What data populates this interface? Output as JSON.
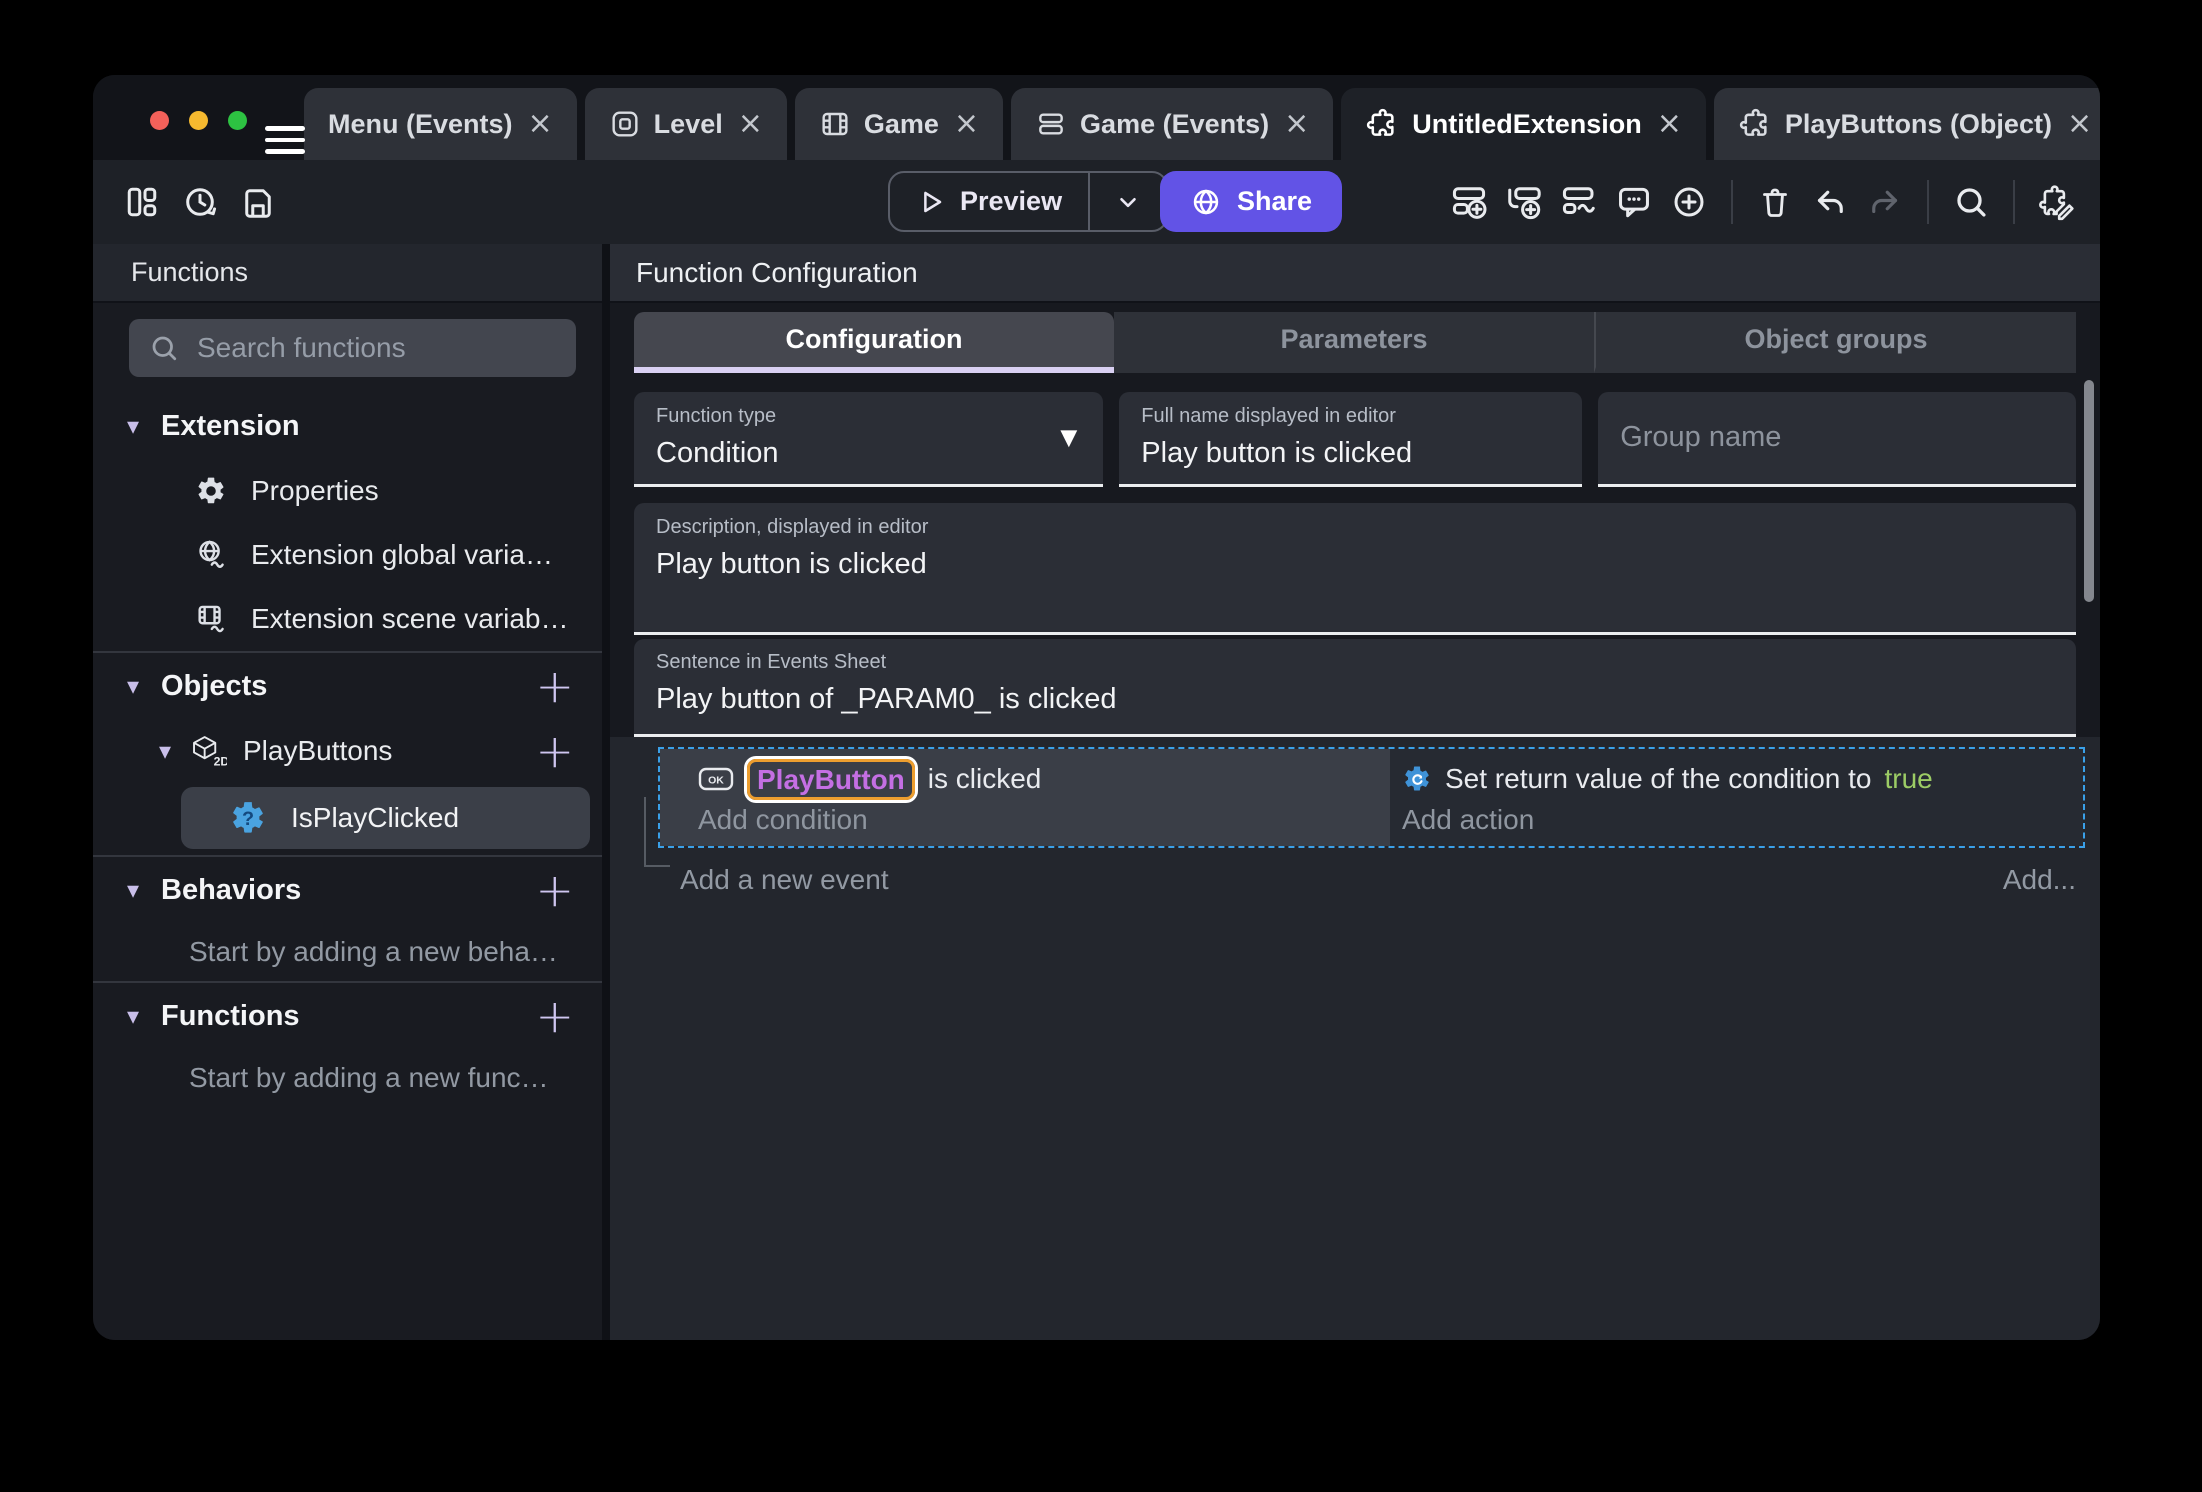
{
  "ui": {
    "tab_close": "×",
    "plus": "+",
    "caret": "▾",
    "dropdown": "▼"
  },
  "tabs": [
    {
      "label": "Menu (Events)"
    },
    {
      "label": "Level",
      "icon": "scene-icon"
    },
    {
      "label": "Game",
      "icon": "film-icon"
    },
    {
      "label": "Game (Events)",
      "icon": "events-sheet-icon"
    },
    {
      "label": "UntitledExtension",
      "icon": "extension-icon",
      "active": true
    },
    {
      "label": "PlayButtons (Object)",
      "icon": "extension-icon"
    }
  ],
  "toolbar": {
    "preview": "Preview",
    "share": "Share"
  },
  "sidebar": {
    "title": "Functions",
    "search_placeholder": "Search functions",
    "extension": {
      "label": "Extension",
      "items": [
        "Properties",
        "Extension global varia…",
        "Extension scene variab…"
      ]
    },
    "objects": {
      "label": "Objects",
      "object_name": "PlayButtons",
      "function_name": "IsPlayClicked"
    },
    "behaviors": {
      "label": "Behaviors",
      "hint": "Start by adding a new beha…"
    },
    "functions": {
      "label": "Functions",
      "hint": "Start by adding a new func…"
    }
  },
  "main": {
    "title": "Function Configuration",
    "tabs": [
      "Configuration",
      "Parameters",
      "Object groups"
    ],
    "active_tab": "Configuration",
    "function_type": {
      "label": "Function type",
      "value": "Condition"
    },
    "full_name": {
      "label": "Full name displayed in editor",
      "value": "Play button is clicked"
    },
    "group_name": {
      "placeholder": "Group name"
    },
    "description": {
      "label": "Description, displayed in editor",
      "value": "Play button is clicked"
    },
    "sentence": {
      "label": "Sentence in Events Sheet",
      "value": "Play button of _PARAM0_ is clicked"
    },
    "events": {
      "condition_object": "PlayButton",
      "condition_object_icon_text": "OK",
      "condition_text": " is clicked",
      "add_condition": "Add condition",
      "action_text": "Set return value of the condition to ",
      "action_value": "true",
      "add_action": "Add action",
      "add_new_event": "Add a new event",
      "add_more": "Add..."
    }
  },
  "colors": {
    "accent_purple": "#6253e6",
    "selection_blue": "#3aa0e8",
    "object_purple": "#c46fe3",
    "highlight_orange": "#ed9e2f",
    "true_green": "#9ccc65",
    "tab_underline": "#d9d0f2"
  }
}
